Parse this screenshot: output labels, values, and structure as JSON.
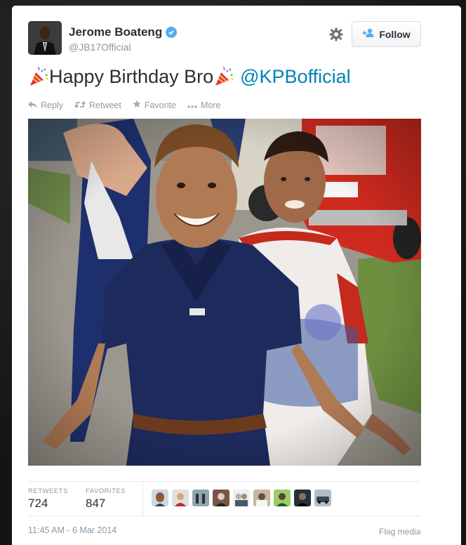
{
  "user": {
    "name": "Jerome Boateng",
    "handle": "@JB17Official"
  },
  "follow_label": "Follow",
  "tweet": {
    "text": "Happy Birthday Bro",
    "mention": "@KPBofficial"
  },
  "actions": {
    "reply": "Reply",
    "retweet": "Retweet",
    "favorite": "Favorite",
    "more": "More"
  },
  "stats": {
    "retweets_label": "RETWEETS",
    "retweets_value": "724",
    "favorites_label": "FAVORITES",
    "favorites_value": "847"
  },
  "timestamp": "11:45 AM - 6 Mar 2014",
  "flag_label": "Flag media",
  "colors": {
    "link": "#0084b4",
    "verified": "#55acee",
    "muted": "#8899a6",
    "text": "#292f33"
  },
  "icons": [
    "verified-icon",
    "gear-icon",
    "follow-icon",
    "party-popper-icon",
    "reply-icon",
    "retweet-icon",
    "favorite-icon",
    "more-icon"
  ]
}
